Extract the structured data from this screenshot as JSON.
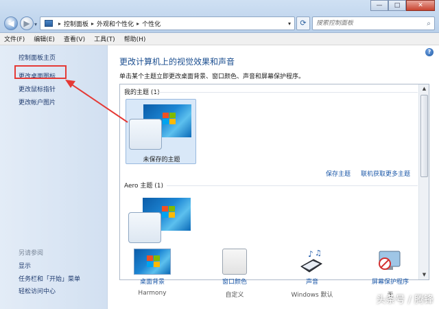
{
  "address": {
    "crumbs": [
      "控制面板",
      "外观和个性化",
      "个性化"
    ]
  },
  "search": {
    "placeholder": "搜索控制面板"
  },
  "menu": [
    "文件(F)",
    "编辑(E)",
    "查看(V)",
    "工具(T)",
    "帮助(H)"
  ],
  "sidebar": {
    "items": [
      "控制面板主页",
      "更改桌面图标",
      "更改鼠标指针",
      "更改帐户图片"
    ],
    "see_also": "另请参阅",
    "see_also_items": [
      "显示",
      "任务栏和「开始」菜单",
      "轻松访问中心"
    ]
  },
  "main": {
    "title": "更改计算机上的视觉效果和声音",
    "description": "单击某个主题立即更改桌面背景、窗口颜色、声音和屏幕保护程序。",
    "my_themes": "我的主题 (1)",
    "unsaved_theme": "未保存的主题",
    "save_theme": "保存主题",
    "get_more": "联机获取更多主题",
    "aero_themes": "Aero 主题 (1)"
  },
  "bottom": [
    {
      "label": "桌面背景",
      "value": "Harmony",
      "icon": "desktop-background-icon"
    },
    {
      "label": "窗口颜色",
      "value": "自定义",
      "icon": "window-color-icon"
    },
    {
      "label": "声音",
      "value": "Windows 默认",
      "icon": "sound-icon"
    },
    {
      "label": "屏幕保护程序",
      "value": "无",
      "icon": "screensaver-icon"
    }
  ],
  "watermark": "头条号 / 腾锋",
  "colors": {
    "highlight": "#e53935",
    "link": "#1c58a8",
    "title": "#1a4d8f"
  }
}
